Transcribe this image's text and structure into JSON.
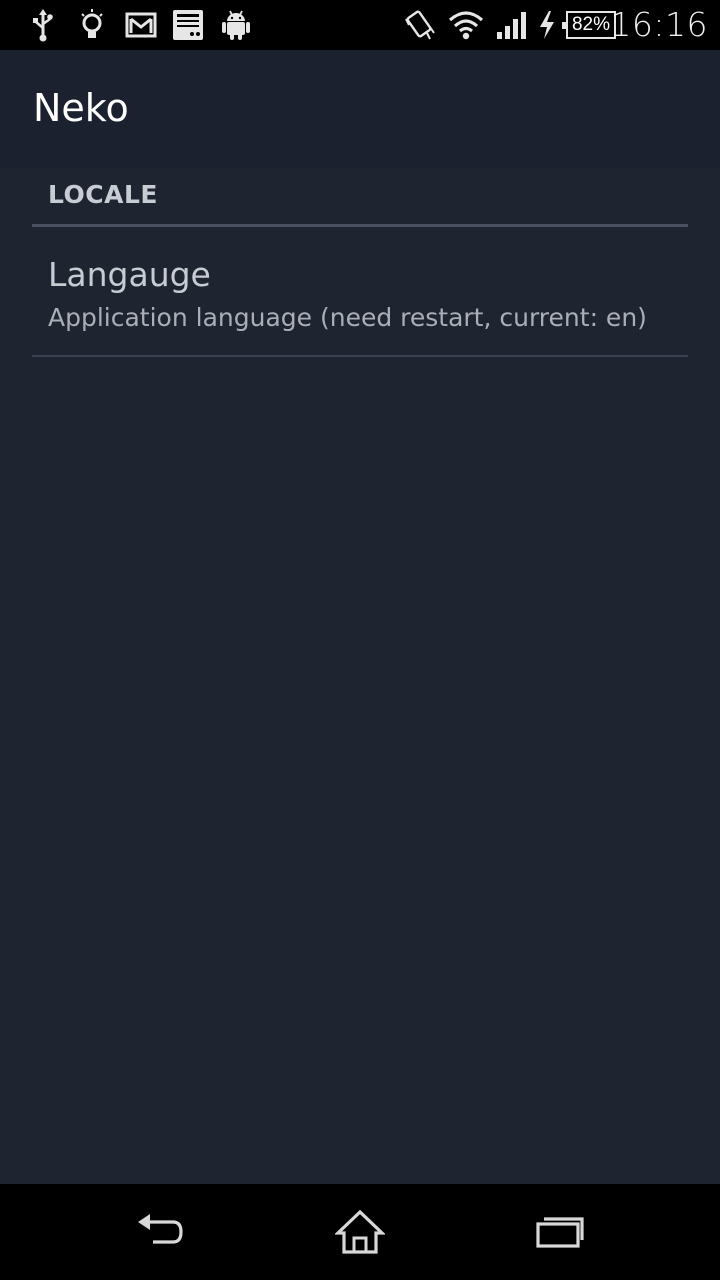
{
  "status_bar": {
    "battery_percent": "82%",
    "time": "16:16",
    "icons_left": [
      "usb-icon",
      "lightbulb-icon",
      "gmail-icon",
      "document-icon",
      "android-icon"
    ],
    "icons_right": [
      "vibrate-icon",
      "wifi-icon",
      "signal-icon",
      "charging-icon",
      "battery-icon"
    ]
  },
  "action_bar": {
    "title": "Neko"
  },
  "preferences": {
    "category_title": "LOCALE",
    "items": [
      {
        "title": "Langauge",
        "summary": "Application language (need restart, current: en)"
      }
    ]
  },
  "nav_bar": {
    "buttons": [
      "back-icon",
      "home-icon",
      "recents-icon"
    ]
  },
  "colors": {
    "background": "#1f2431",
    "action_bar": "#1c2130",
    "status_bar": "#000000",
    "nav_bar": "#000000",
    "divider": "#4a5160",
    "text_primary": "#c7cbd2",
    "text_secondary": "#a9aeb7"
  }
}
